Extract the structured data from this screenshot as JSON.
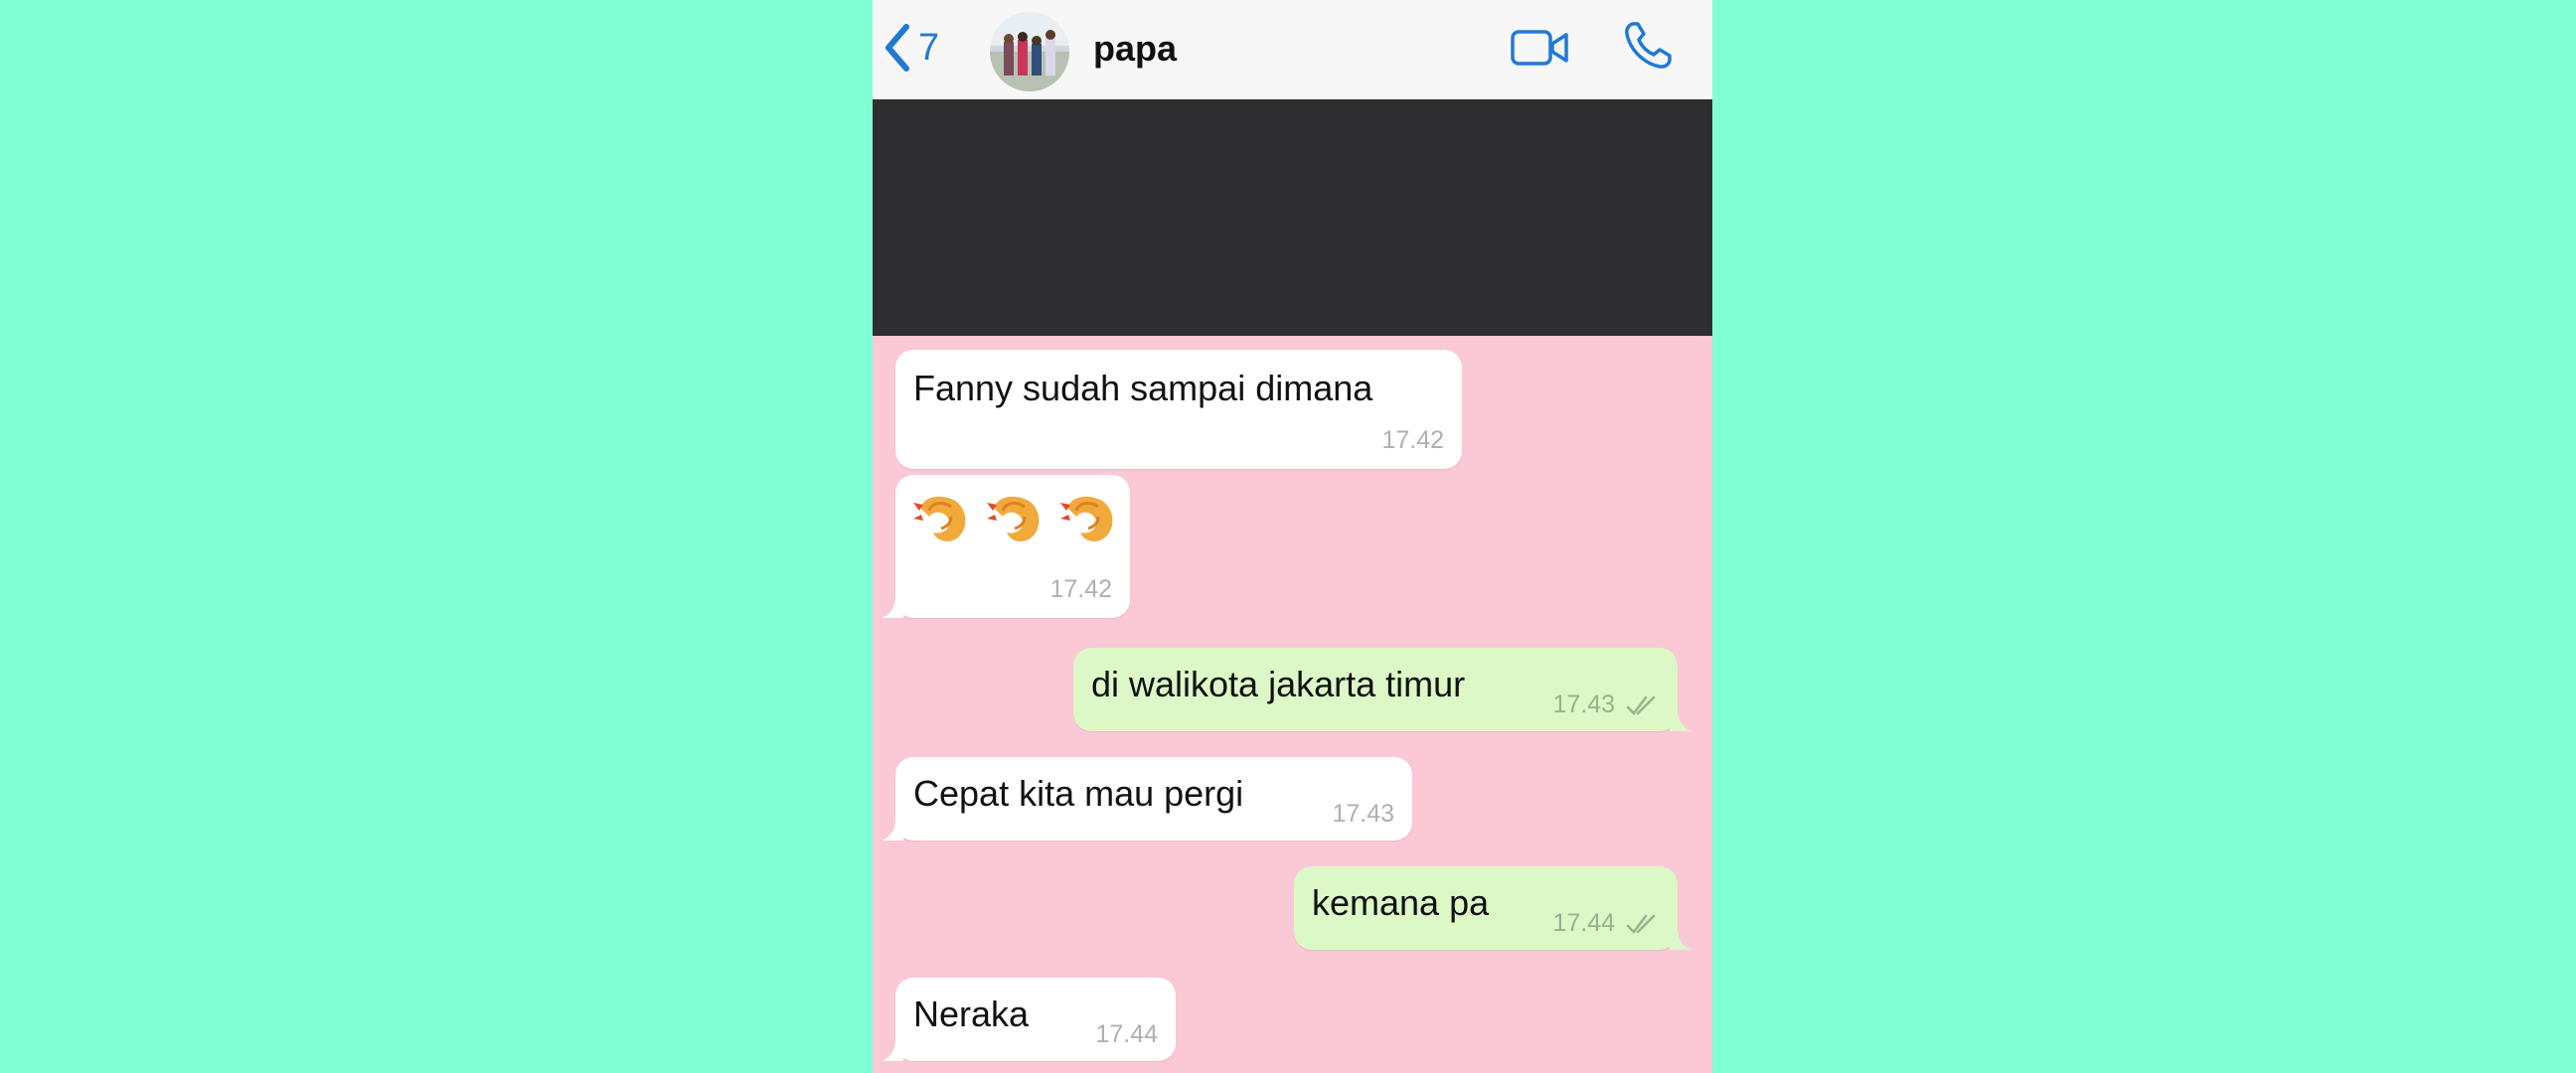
{
  "header": {
    "back_count": "7",
    "contact_name": "papa"
  },
  "messages": [
    {
      "direction": "incoming",
      "text": "Fanny sudah sampai dimana",
      "time": "17.42"
    },
    {
      "direction": "incoming",
      "emoji": [
        "fried-shrimp",
        "fried-shrimp",
        "fried-shrimp"
      ],
      "time": "17.42"
    },
    {
      "direction": "outgoing",
      "text": "di walikota jakarta timur",
      "time": "17.43",
      "status": "read"
    },
    {
      "direction": "incoming",
      "text": "Cepat kita mau pergi",
      "time": "17.43"
    },
    {
      "direction": "outgoing",
      "text": "kemana pa",
      "time": "17.44",
      "status": "read"
    },
    {
      "direction": "incoming",
      "text": "Neraka",
      "time": "17.44"
    }
  ],
  "colors": {
    "page_background": "#80ffd4",
    "chat_background": "#fbc8d6",
    "incoming_bubble": "#ffffff",
    "outgoing_bubble": "#dcf8c6",
    "accent": "#1f7ad6"
  }
}
